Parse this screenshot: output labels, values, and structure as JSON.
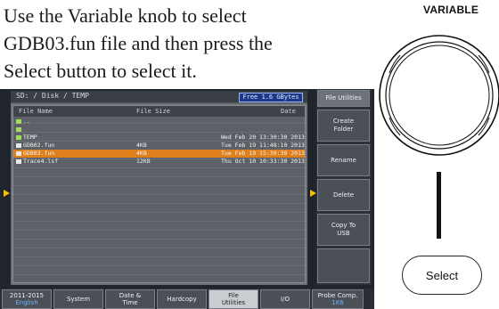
{
  "instruction": {
    "line1": "Use the Variable knob to select",
    "line2": "GDB03.fun file and then press the",
    "line3": "Select button to select it."
  },
  "knob": {
    "label": "VARIABLE"
  },
  "select_button": {
    "label": "Select"
  },
  "screen": {
    "path": "SD: / Disk / TEMP",
    "free_space": "Free 1.6 GBytes",
    "headers": {
      "name": "File Name",
      "size": "File Size",
      "date": "Date"
    },
    "rows": [
      {
        "icon": "folder",
        "name": "..",
        "size": "",
        "date": ""
      },
      {
        "icon": "folder",
        "name": "",
        "size": "",
        "date": ""
      },
      {
        "icon": "folder",
        "name": "TEMP",
        "size": "",
        "date": "Wed Feb 20 13:30:30 2013"
      },
      {
        "icon": "file",
        "name": "GDB02.fun",
        "size": "4KB",
        "date": "Tue Feb 19 11:48:10 2013"
      },
      {
        "icon": "file",
        "name": "GDB03.fun",
        "size": "4KB",
        "date": "Tue Feb 19 15:30:30 2013",
        "selected": true
      },
      {
        "icon": "file",
        "name": "Trace4.lsf",
        "size": "12KB",
        "date": "Thu Oct 10 10:33:30 2013"
      }
    ]
  },
  "side_menu": {
    "title": "File Utilities",
    "items": [
      "Create\nFolder",
      "Rename",
      "Delete",
      "Copy To\nUSB",
      ""
    ]
  },
  "bottom_menu": [
    {
      "label": "2011-2015",
      "sub": "English"
    },
    {
      "label": "System",
      "sub": ""
    },
    {
      "label": "Date &\nTime",
      "sub": ""
    },
    {
      "label": "Hardcopy",
      "sub": ""
    },
    {
      "label": "File\nUtilities",
      "sub": "",
      "active": true
    },
    {
      "label": "I/O",
      "sub": ""
    },
    {
      "label": "Probe Comp.",
      "sub": "1K6"
    }
  ]
}
